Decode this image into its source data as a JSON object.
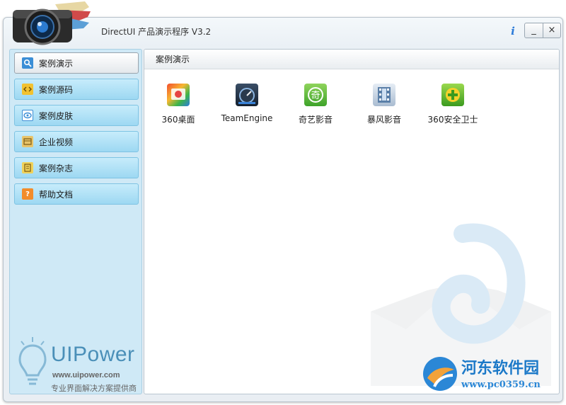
{
  "window": {
    "title": "DirectUI 产品演示程序 V3.2",
    "info_label": "i",
    "minimize_label": "_",
    "close_label": "×"
  },
  "sidebar": {
    "items": [
      {
        "label": "案例演示",
        "icon": "magnifier-icon",
        "active": true
      },
      {
        "label": "案例源码",
        "icon": "code-icon",
        "active": false
      },
      {
        "label": "案例皮肤",
        "icon": "skin-icon",
        "active": false
      },
      {
        "label": "企业视频",
        "icon": "video-icon",
        "active": false
      },
      {
        "label": "案例杂志",
        "icon": "magazine-icon",
        "active": false
      },
      {
        "label": "帮助文档",
        "icon": "help-icon",
        "active": false
      }
    ],
    "brand": {
      "name": "UIPower",
      "url": "www.uipower.com",
      "tagline": "专业界面解决方案提供商"
    }
  },
  "main": {
    "header": "案例演示",
    "apps": [
      {
        "label": "360桌面",
        "icon": "360-desktop-icon"
      },
      {
        "label": "TeamEngine",
        "icon": "teamengine-icon"
      },
      {
        "label": "奇艺影音",
        "icon": "qiyi-icon"
      },
      {
        "label": "暴风影音",
        "icon": "baofeng-icon"
      },
      {
        "label": "360安全卫士",
        "icon": "360-safe-icon"
      }
    ]
  },
  "watermark": {
    "site_name": "河东软件园",
    "site_url": "www.pc0359.cn"
  },
  "colors": {
    "accent": "#2b7ad8",
    "sidebar_bg": "#cfe9f6",
    "nav_button": "#9dd8f2",
    "brand": "#4a8fb8"
  }
}
